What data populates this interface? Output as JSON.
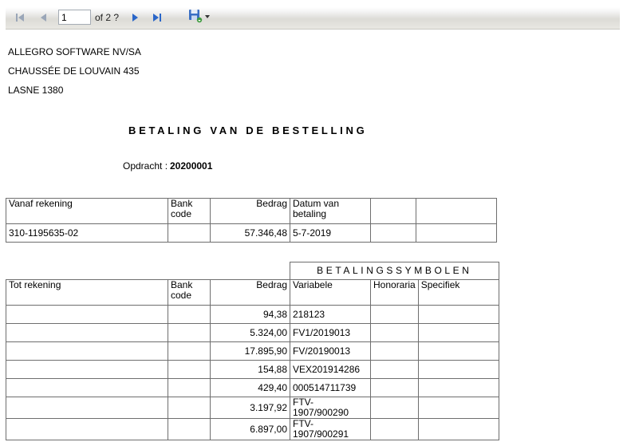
{
  "toolbar": {
    "first_page_icon": "first-page-icon",
    "prev_page_icon": "previous-page-icon",
    "page_value": "1",
    "page_of": "of 2 ?",
    "next_page_icon": "next-page-icon",
    "last_page_icon": "last-page-icon",
    "export_icon": "floppy-export-icon",
    "accent_color": "#2a66c8"
  },
  "report": {
    "address": [
      "ALLEGRO SOFTWARE NV/SA",
      "CHAUSSÉE DE LOUVAIN 435",
      "LASNE 1380"
    ],
    "title": "BETALING VAN DE BESTELLING",
    "order_label": "Opdracht :",
    "order_value": "20200001",
    "from_table": {
      "headers": [
        "Vanaf rekening",
        "Bank code",
        "Bedrag",
        "Datum van betaling",
        "",
        ""
      ],
      "row": [
        "310-1195635-02",
        "",
        "57.346,48",
        "5-7-2019",
        "",
        ""
      ]
    },
    "to_table": {
      "group_header": "BETALINGSSYMBOLEN",
      "headers": [
        "Tot rekening",
        "Bank code",
        "Bedrag",
        "Variabele",
        "Honoraria",
        "Specifiek"
      ],
      "rows": [
        [
          "",
          "",
          "94,38",
          "218123",
          "",
          ""
        ],
        [
          "",
          "",
          "5.324,00",
          "FV1/2019013",
          "",
          ""
        ],
        [
          "",
          "",
          "17.895,90",
          "FV/20190013",
          "",
          ""
        ],
        [
          "",
          "",
          "154,88",
          "VEX201914286",
          "",
          ""
        ],
        [
          "",
          "",
          "429,40",
          "000514711739",
          "",
          ""
        ],
        [
          "",
          "",
          "3.197,92",
          "FTV-1907/900290",
          "",
          ""
        ],
        [
          "",
          "",
          "6.897,00",
          "FTV-1907/900291",
          "",
          ""
        ]
      ]
    }
  }
}
